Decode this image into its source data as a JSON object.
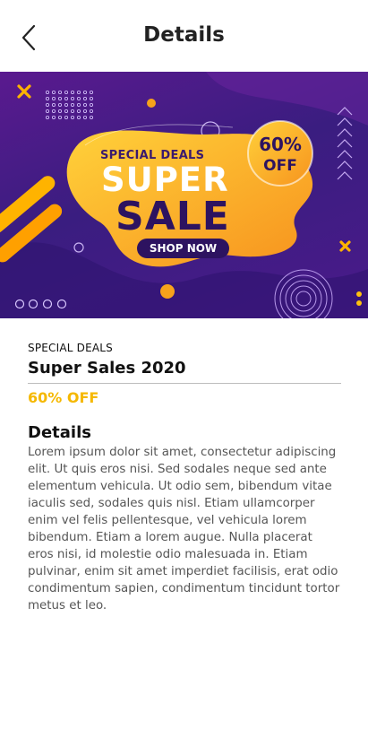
{
  "header": {
    "title": "Details",
    "back_icon": "chevron-left-icon"
  },
  "banner": {
    "special_deals": "SPECIAL DEALS",
    "super": "SUPER",
    "sale": "SALE",
    "shop_now": "SHOP NOW",
    "percent": "60%",
    "off": "OFF",
    "colors": {
      "background": "#3a1d80",
      "accent_orange": "#f7931e",
      "accent_yellow": "#ffc20e",
      "dark_purple": "#2d1360"
    }
  },
  "product": {
    "eyebrow": "SPECIAL DEALS",
    "title": "Super Sales 2020",
    "discount": "60% OFF",
    "details_heading": "Details",
    "description": "Lorem ipsum dolor sit amet, consectetur adipiscing elit. Ut quis eros nisi. Sed sodales neque sed ante elementum vehicula. Ut odio sem, bibendum vitae iaculis sed, sodales quis nisl. Etiam ullamcorper enim vel felis pellentesque, vel vehicula lorem bibendum. Etiam a lorem augue. Nulla placerat eros nisi, id molestie odio malesuada in. Etiam pulvinar, enim sit amet imperdiet facilisis, erat odio condimentum sapien, condimentum tincidunt tortor metus et leo.",
    "accent_color": "#f5b800"
  }
}
